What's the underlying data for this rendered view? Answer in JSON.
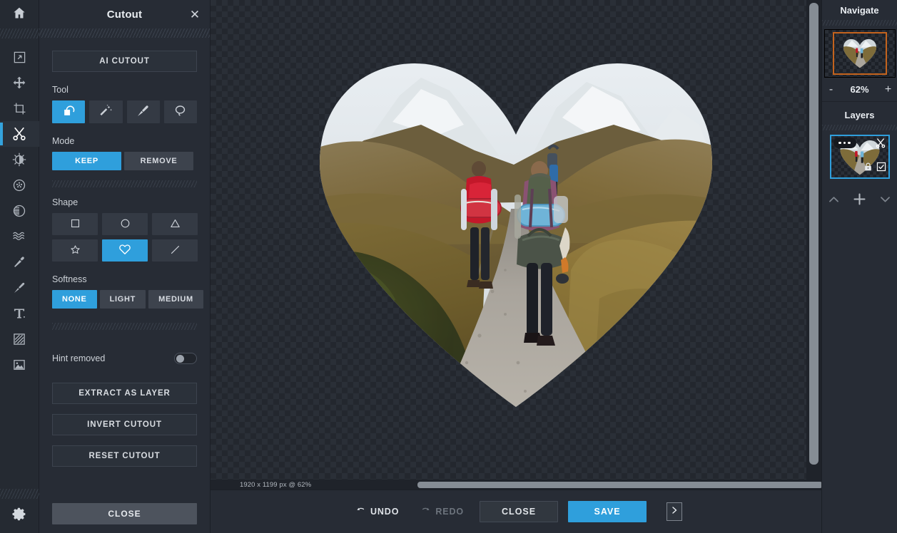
{
  "rail": {
    "home_icon": "home-icon",
    "tools": [
      {
        "name": "resize-icon",
        "label": "Resize",
        "active": false
      },
      {
        "name": "move-icon",
        "label": "Move",
        "active": false
      },
      {
        "name": "crop-icon",
        "label": "Crop",
        "active": false
      },
      {
        "name": "scissors-icon",
        "label": "Cutout",
        "active": true
      },
      {
        "name": "brightness-icon",
        "label": "Adjust",
        "active": false
      },
      {
        "name": "dots-circle-icon",
        "label": "Effects",
        "active": false
      },
      {
        "name": "gradient-circle-icon",
        "label": "Filter",
        "active": false
      },
      {
        "name": "waves-icon",
        "label": "Distort",
        "active": false
      },
      {
        "name": "retouch-icon",
        "label": "Retouch",
        "active": false
      },
      {
        "name": "paintbrush-icon",
        "label": "Draw",
        "active": false
      },
      {
        "name": "text-icon",
        "label": "Text",
        "active": false
      },
      {
        "name": "texture-icon",
        "label": "Texture",
        "active": false
      },
      {
        "name": "image-icon",
        "label": "Image",
        "active": false
      }
    ],
    "gear_icon": "gear-icon"
  },
  "panel": {
    "title": "Cutout",
    "close_icon": "close-icon",
    "ai_cutout_label": "AI CUTOUT",
    "tool_section_label": "Tool",
    "tool_options": [
      {
        "icon": "shape-fill-icon",
        "selected": true
      },
      {
        "icon": "magic-wand-icon",
        "selected": false
      },
      {
        "icon": "brush-icon",
        "selected": false
      },
      {
        "icon": "lasso-icon",
        "selected": false
      }
    ],
    "mode_section_label": "Mode",
    "mode_options": [
      {
        "label": "KEEP",
        "selected": true
      },
      {
        "label": "REMOVE",
        "selected": false
      }
    ],
    "shape_section_label": "Shape",
    "shape_options": [
      {
        "icon": "square-icon",
        "selected": false
      },
      {
        "icon": "circle-icon",
        "selected": false
      },
      {
        "icon": "triangle-icon",
        "selected": false
      },
      {
        "icon": "star-icon",
        "selected": false
      },
      {
        "icon": "heart-icon",
        "selected": true
      },
      {
        "icon": "line-icon",
        "selected": false
      }
    ],
    "softness_section_label": "Softness",
    "softness_options": [
      {
        "label": "NONE",
        "selected": true
      },
      {
        "label": "LIGHT",
        "selected": false
      },
      {
        "label": "MEDIUM",
        "selected": false
      }
    ],
    "hint_removed_label": "Hint removed",
    "hint_removed_on": false,
    "extract_label": "EXTRACT AS LAYER",
    "invert_label": "INVERT CUTOUT",
    "reset_label": "RESET CUTOUT",
    "close_label": "CLOSE"
  },
  "canvas": {
    "status_text": "1920 x 1199 px @ 62%",
    "shape": "heart",
    "image_description": "Two hikers with backpacks walking along a gravel trail through golden moorland toward snow-capped mountains"
  },
  "bottombar": {
    "undo_label": "UNDO",
    "redo_label": "REDO",
    "undo_icon": "undo-arrow-icon",
    "redo_icon": "redo-arrow-icon",
    "redo_disabled": true,
    "close_label": "CLOSE",
    "save_label": "SAVE",
    "expand_icon": "chevron-right-icon"
  },
  "right": {
    "navigate_title": "Navigate",
    "zoom_out_label": "-",
    "zoom_value": "62%",
    "zoom_in_label": "+",
    "layers_title": "Layers",
    "layer": {
      "menu_icon": "more-dots-icon",
      "scissors_icon": "scissors-icon",
      "lock_icon": "lock-icon",
      "visible_icon": "checkbox-checked-icon"
    },
    "layer_actions": [
      {
        "icon": "chevron-up-icon"
      },
      {
        "icon": "plus-icon"
      },
      {
        "icon": "chevron-down-icon"
      }
    ]
  },
  "colors": {
    "accent": "#2f9fdc",
    "panel_bg": "#272c35",
    "rail_bg": "#252a32",
    "navigator_view_border": "#c4631d",
    "text": "#d6dae0"
  }
}
